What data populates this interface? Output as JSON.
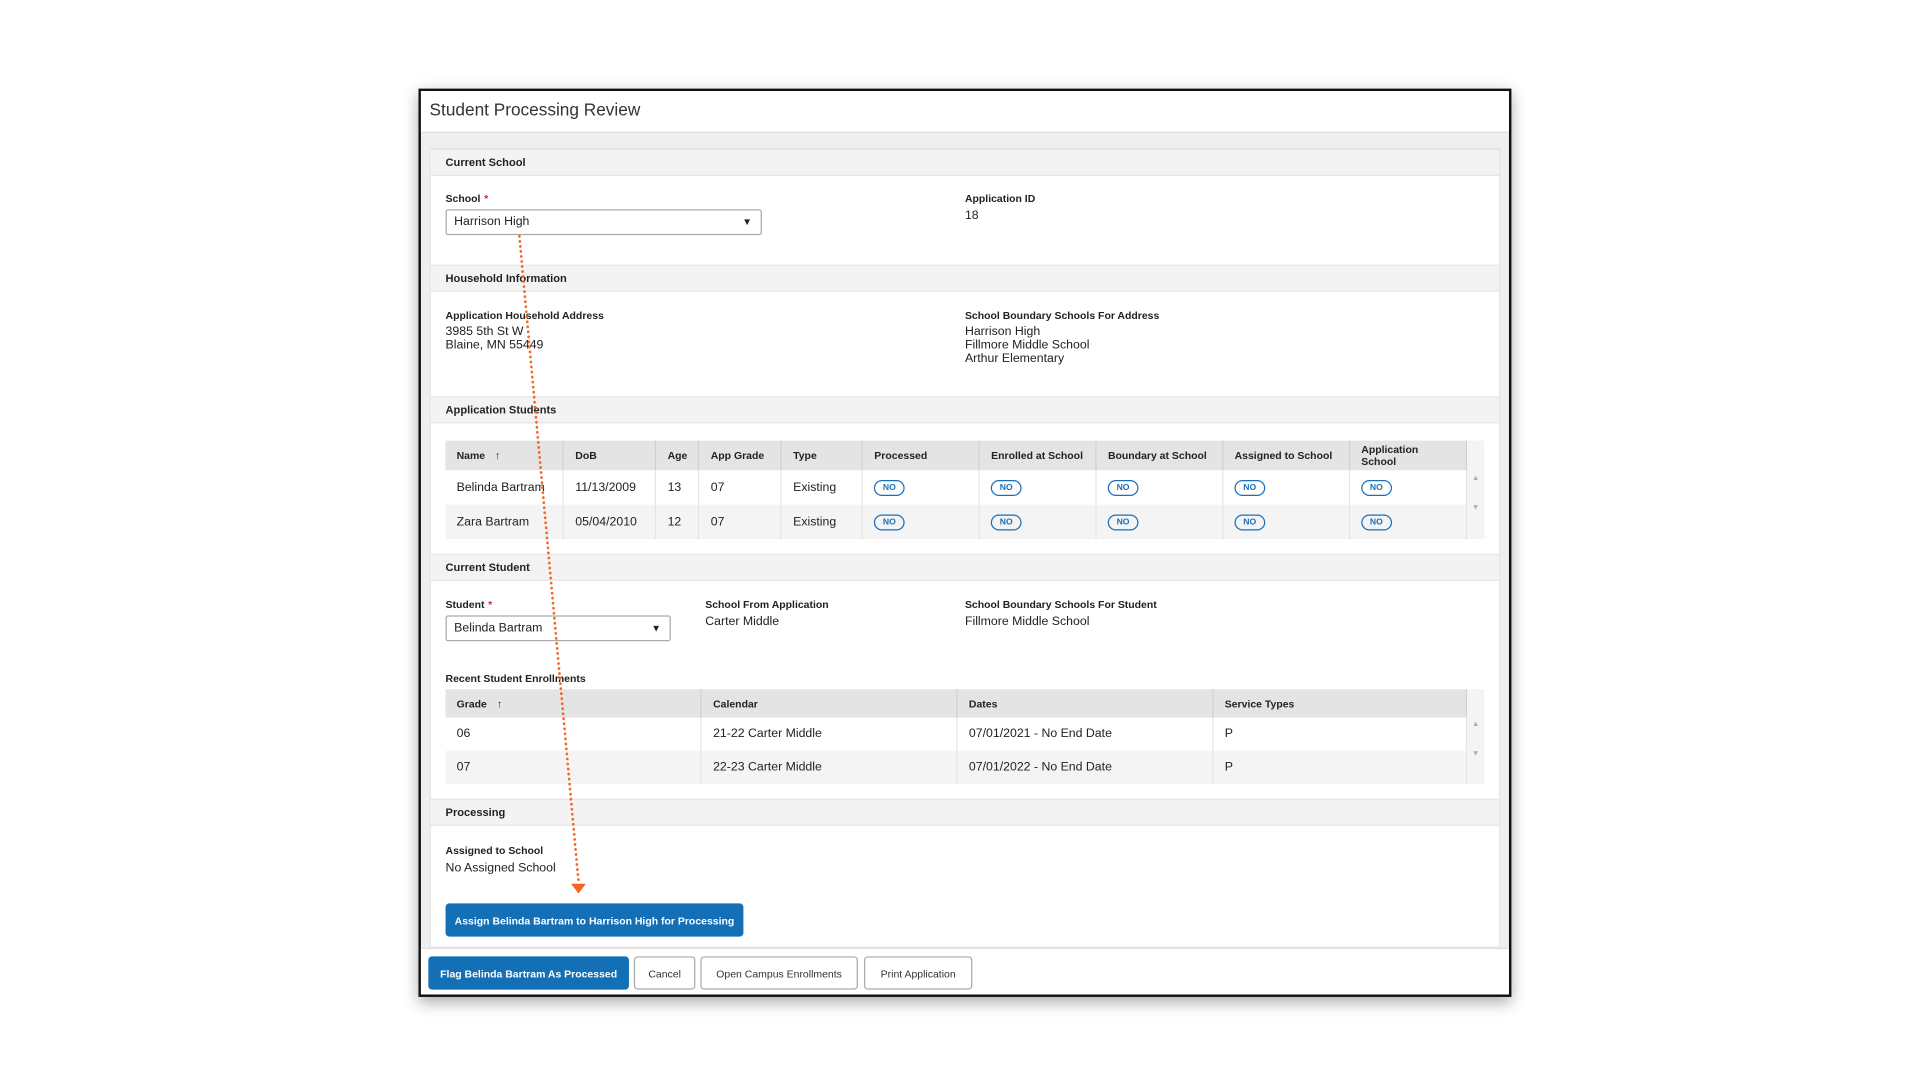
{
  "title": "Student Processing Review",
  "current_school": {
    "header": "Current School",
    "school_label": "School",
    "required": "*",
    "school_value": "Harrison High",
    "app_id_label": "Application ID",
    "app_id_value": "18"
  },
  "household": {
    "header": "Household Information",
    "address_label": "Application Household Address",
    "address_line1": "3985 5th St W",
    "address_line2": "Blaine, MN 55449",
    "boundary_label": "School Boundary Schools For Address",
    "boundary_schools": [
      "Harrison High",
      "Fillmore Middle School",
      "Arthur Elementary"
    ]
  },
  "students": {
    "header": "Application Students",
    "columns": [
      "Name",
      "DoB",
      "Age",
      "App Grade",
      "Type",
      "Processed",
      "Enrolled at School",
      "Boundary at School",
      "Assigned to School",
      "Application School"
    ],
    "sort_icon": "↑",
    "rows": [
      [
        "Belinda Bartram",
        "11/13/2009",
        "13",
        "07",
        "Existing",
        "NO",
        "NO",
        "NO",
        "NO",
        "NO"
      ],
      [
        "Zara Bartram",
        "05/04/2010",
        "12",
        "07",
        "Existing",
        "NO",
        "NO",
        "NO",
        "NO",
        "NO"
      ]
    ]
  },
  "current_student": {
    "header": "Current Student",
    "student_label": "Student",
    "student_value": "Belinda Bartram",
    "school_from_app_label": "School From Application",
    "school_from_app_value": "Carter Middle",
    "boundary_label": "School Boundary Schools For Student",
    "boundary_value": "Fillmore Middle School"
  },
  "enrollments": {
    "label": "Recent Student Enrollments",
    "columns": [
      "Grade",
      "Calendar",
      "Dates",
      "Service Types"
    ],
    "rows": [
      [
        "06",
        "21-22 Carter Middle",
        "07/01/2021 - No End Date",
        "P"
      ],
      [
        "07",
        "22-23 Carter Middle",
        "07/01/2022 - No End Date",
        "P"
      ]
    ]
  },
  "processing": {
    "header": "Processing",
    "assigned_label": "Assigned to School",
    "assigned_value": "No Assigned School",
    "assign_button": "Assign Belinda Bartram to Harrison High for Processing"
  },
  "footer": {
    "flag_button": "Flag Belinda Bartram As Processed",
    "cancel_button": "Cancel",
    "open_button": "Open Campus Enrollments",
    "print_button": "Print Application"
  },
  "colors": {
    "primary": "#136fb6",
    "annotation_arrow": "#f26522",
    "required": "#c62828"
  }
}
